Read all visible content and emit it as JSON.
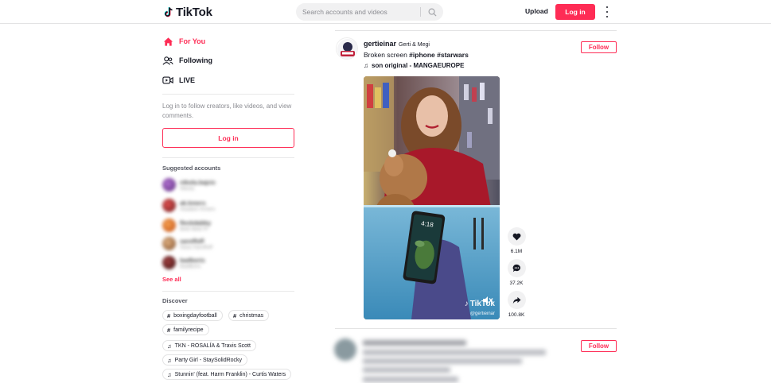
{
  "header": {
    "logo_text": "TikTok",
    "search_placeholder": "Search accounts and videos",
    "upload_label": "Upload",
    "login_label": "Log in"
  },
  "sidebar": {
    "nav": [
      {
        "label": "For You",
        "icon": "home-icon",
        "active": true
      },
      {
        "label": "Following",
        "icon": "users-icon",
        "active": false
      },
      {
        "label": "LIVE",
        "icon": "live-icon",
        "active": false
      }
    ],
    "login_prompt": "Log in to follow creators, like videos, and view comments.",
    "login_button": "Log in",
    "suggested_title": "Suggested accounts",
    "suggested_accounts": [
      {
        "name": "nikola.bajcic",
        "sub": "Nikola"
      },
      {
        "name": "ak.kmers",
        "sub": "Akadem Kmers"
      },
      {
        "name": "fleckdabby",
        "sub": "Bebi Bebi Pi"
      },
      {
        "name": "saroffoff",
        "sub": "Sasa Saroffoff"
      },
      {
        "name": "badboris",
        "sub": "BadBoris"
      }
    ],
    "see_all": "See all",
    "discover_title": "Discover",
    "discover_tags": [
      {
        "label": "boxingdayfootball",
        "kind": "hashtag"
      },
      {
        "label": "christmas",
        "kind": "hashtag"
      },
      {
        "label": "familyrecipe",
        "kind": "hashtag"
      },
      {
        "label": "TKN - ROSALÍA & Travis Scott",
        "kind": "music"
      },
      {
        "label": "Party Girl - StaySolidRocky",
        "kind": "music"
      },
      {
        "label": "Stunnin' (feat. Harm Franklin) - Curtis Waters",
        "kind": "music"
      }
    ]
  },
  "post": {
    "username": "gertieinar",
    "nickname": "Gerti & Megi",
    "caption_text": "Broken screen ",
    "hashtags": "#iphone #starwars",
    "music": "son original - MANGAEUROPE",
    "follow_label": "Follow",
    "video_brand": "TikTok",
    "video_watermark": "@gertieinar",
    "phone_time": "4:18",
    "likes": "6.1M",
    "comments": "37.2K",
    "shares": "100.8K"
  },
  "next_post": {
    "follow_label": "Follow"
  },
  "colors": {
    "brand": "#fe2c55",
    "text": "#161823",
    "muted": "#8a8b91"
  }
}
